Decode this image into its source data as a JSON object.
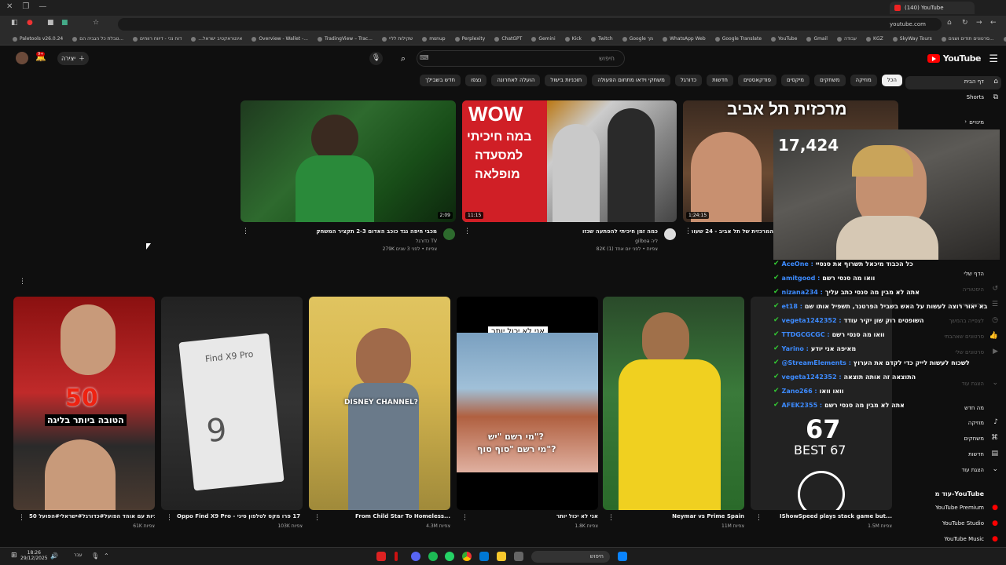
{
  "browser": {
    "tab_title": "(140) YouTube",
    "url": "youtube.com",
    "bookmarks": [
      "Paletools v26.0.24",
      "טבלת כל הגביה הם...",
      "דוח נכי - דיווח רווחים",
      "...אינטראקטיב ישראל",
      "Overview - Wallet -...",
      "TradingView – Trac...",
      "שקילות לליי",
      "msnup",
      "Perplexity",
      "ChatGPT",
      "Gemini",
      "Kick",
      "Twitch",
      "Google מך",
      "WhatsApp Web",
      "Google Translate",
      "YouTube",
      "Gmail",
      "עבודה",
      "KGZ",
      "SkyWay Tours",
      "סרטונים תודים ושגים...",
      "משחקים",
      "כללי"
    ]
  },
  "header": {
    "logo": "YouTube",
    "search_placeholder": "חיפוש",
    "create_label": "יצירה",
    "bell_badge": "9+"
  },
  "chips": [
    "הכל",
    "מוזיקה",
    "משחקים",
    "מיקסים",
    "פודקאסטים",
    "חדשות",
    "כדורגל",
    "משחקי וידאו מתחום הפעולה",
    "תוכניות בישול",
    "הועלה לאחרונה",
    "נצפו",
    "חדש בשבילך"
  ],
  "sidebar": {
    "home": "דף הבית",
    "shorts": "Shorts",
    "subscriptions": "מינויים",
    "you_header": "הדף שלי",
    "history": "היסטוריה",
    "playlists": "פלייליסטים",
    "watch_later": "לצפייה בהמשך",
    "liked": "סרטונים שאהבתי",
    "your_videos": "סרטונים שלי",
    "show_more": "הצגת עוד",
    "explore_header": "מה חדש",
    "music": "מוזיקה",
    "gaming": "משחקים",
    "news": "חדשות",
    "show_more2": "הצגת עוד",
    "more_from_yt": "עוד מ-YouTube",
    "yt_premium": "YouTube Premium",
    "yt_studio": "YouTube Studio",
    "yt_music": "YouTube Music"
  },
  "videos": [
    {
      "title": "מכבי חיפה נגד כוכב האדום 2-3 תקציר המשחק",
      "channel": "כדורגל TV",
      "meta": "279K צפיות • לפני 3 שנים",
      "duration": "2:09"
    },
    {
      "title": "כמה זמן חיכיתי להפתעה שכזו",
      "channel": "gilboa ליה",
      "meta": "82K צפיות • לפני יום אחד (1)",
      "duration": "11:15",
      "overlay1": "WOW",
      "overlay2": "במה חיכיתי",
      "overlay3": "למסעדה",
      "overlay4": "מופלאה"
    },
    {
      "title": "המרכזית של תל אביב - 24 שעות שורד במקום הכי מטורף",
      "channel": "",
      "meta": "",
      "duration": "1:24:15",
      "overlay1": "מרכזית תל אביב"
    }
  ],
  "shorts": [
    {
      "title": "50 שניות עם אוהד הפועל#כדורגל#ישראלי#הפועל",
      "meta": "61K צפיות",
      "overlay1": "50",
      "overlay2": "הטובה ביותר בליגה"
    },
    {
      "title": "Oppo Find X9 Pro - עבר מאייפון 17 פרו מקס לטלפון סיני",
      "meta": "103K צפיות",
      "overlay1": "Find X9 Pro",
      "overlay2": "9"
    },
    {
      "title": "From Child Star To Homeless...",
      "meta": "4.3M צפיות",
      "overlay1": "DISNEY CHANNEL?"
    },
    {
      "title": "אני לא יכול יותר",
      "meta": "1.8K צפיות",
      "overlay1": "אני לא יכול יותר",
      "overlay2": "מי רשם \"יש\"?",
      "overlay3": "מי רשם \"סוף סוף\"?"
    },
    {
      "title": "Neymar vs Prime Spain",
      "meta": "11M צפיות"
    },
    {
      "title": "IShowSpeed plays stack game but...",
      "meta": "1.5M צפיות",
      "overlay1": "67",
      "overlay2": "BEST 67"
    }
  ],
  "stream": {
    "viewer_count": "17,424",
    "chat": [
      {
        "user": "AceOne",
        "text": "כל הכבוד מיכאל תשרוף את סנסיי"
      },
      {
        "user": "amitgood",
        "text": "וואו מה סנסי רשם"
      },
      {
        "user": "nizana234",
        "text": "אתה לא מבין מה סנסי כתב עליך"
      },
      {
        "user": "et18",
        "text": "בא יאור רוצה לעשות על האש בשביל הפרטנר, תשפיל אותו שם"
      },
      {
        "user": "vegeta1242352",
        "text": "השופטים רוק שון יקיר עודד"
      },
      {
        "user": "TTDGCGCGC",
        "text": "וואו מה סנסי רשם"
      },
      {
        "user": "Yarino",
        "text": "מאיפה אני יודע"
      },
      {
        "user": "@StreamElements",
        "text": "לשכוח לעשות לייק כדי לקדם את הערוץ"
      },
      {
        "user": "vegeta1242352",
        "text": "התוצאה זה אותה תוצאה"
      },
      {
        "user": "Zano266",
        "text": "וואו וואו"
      },
      {
        "user": "AFEK2355",
        "text": "אתה לא מבין מה סנסי רשם"
      }
    ]
  },
  "taskbar": {
    "time": "18:26",
    "date": "29/12/2025",
    "search": "חיפוש",
    "lang": "עבר"
  }
}
